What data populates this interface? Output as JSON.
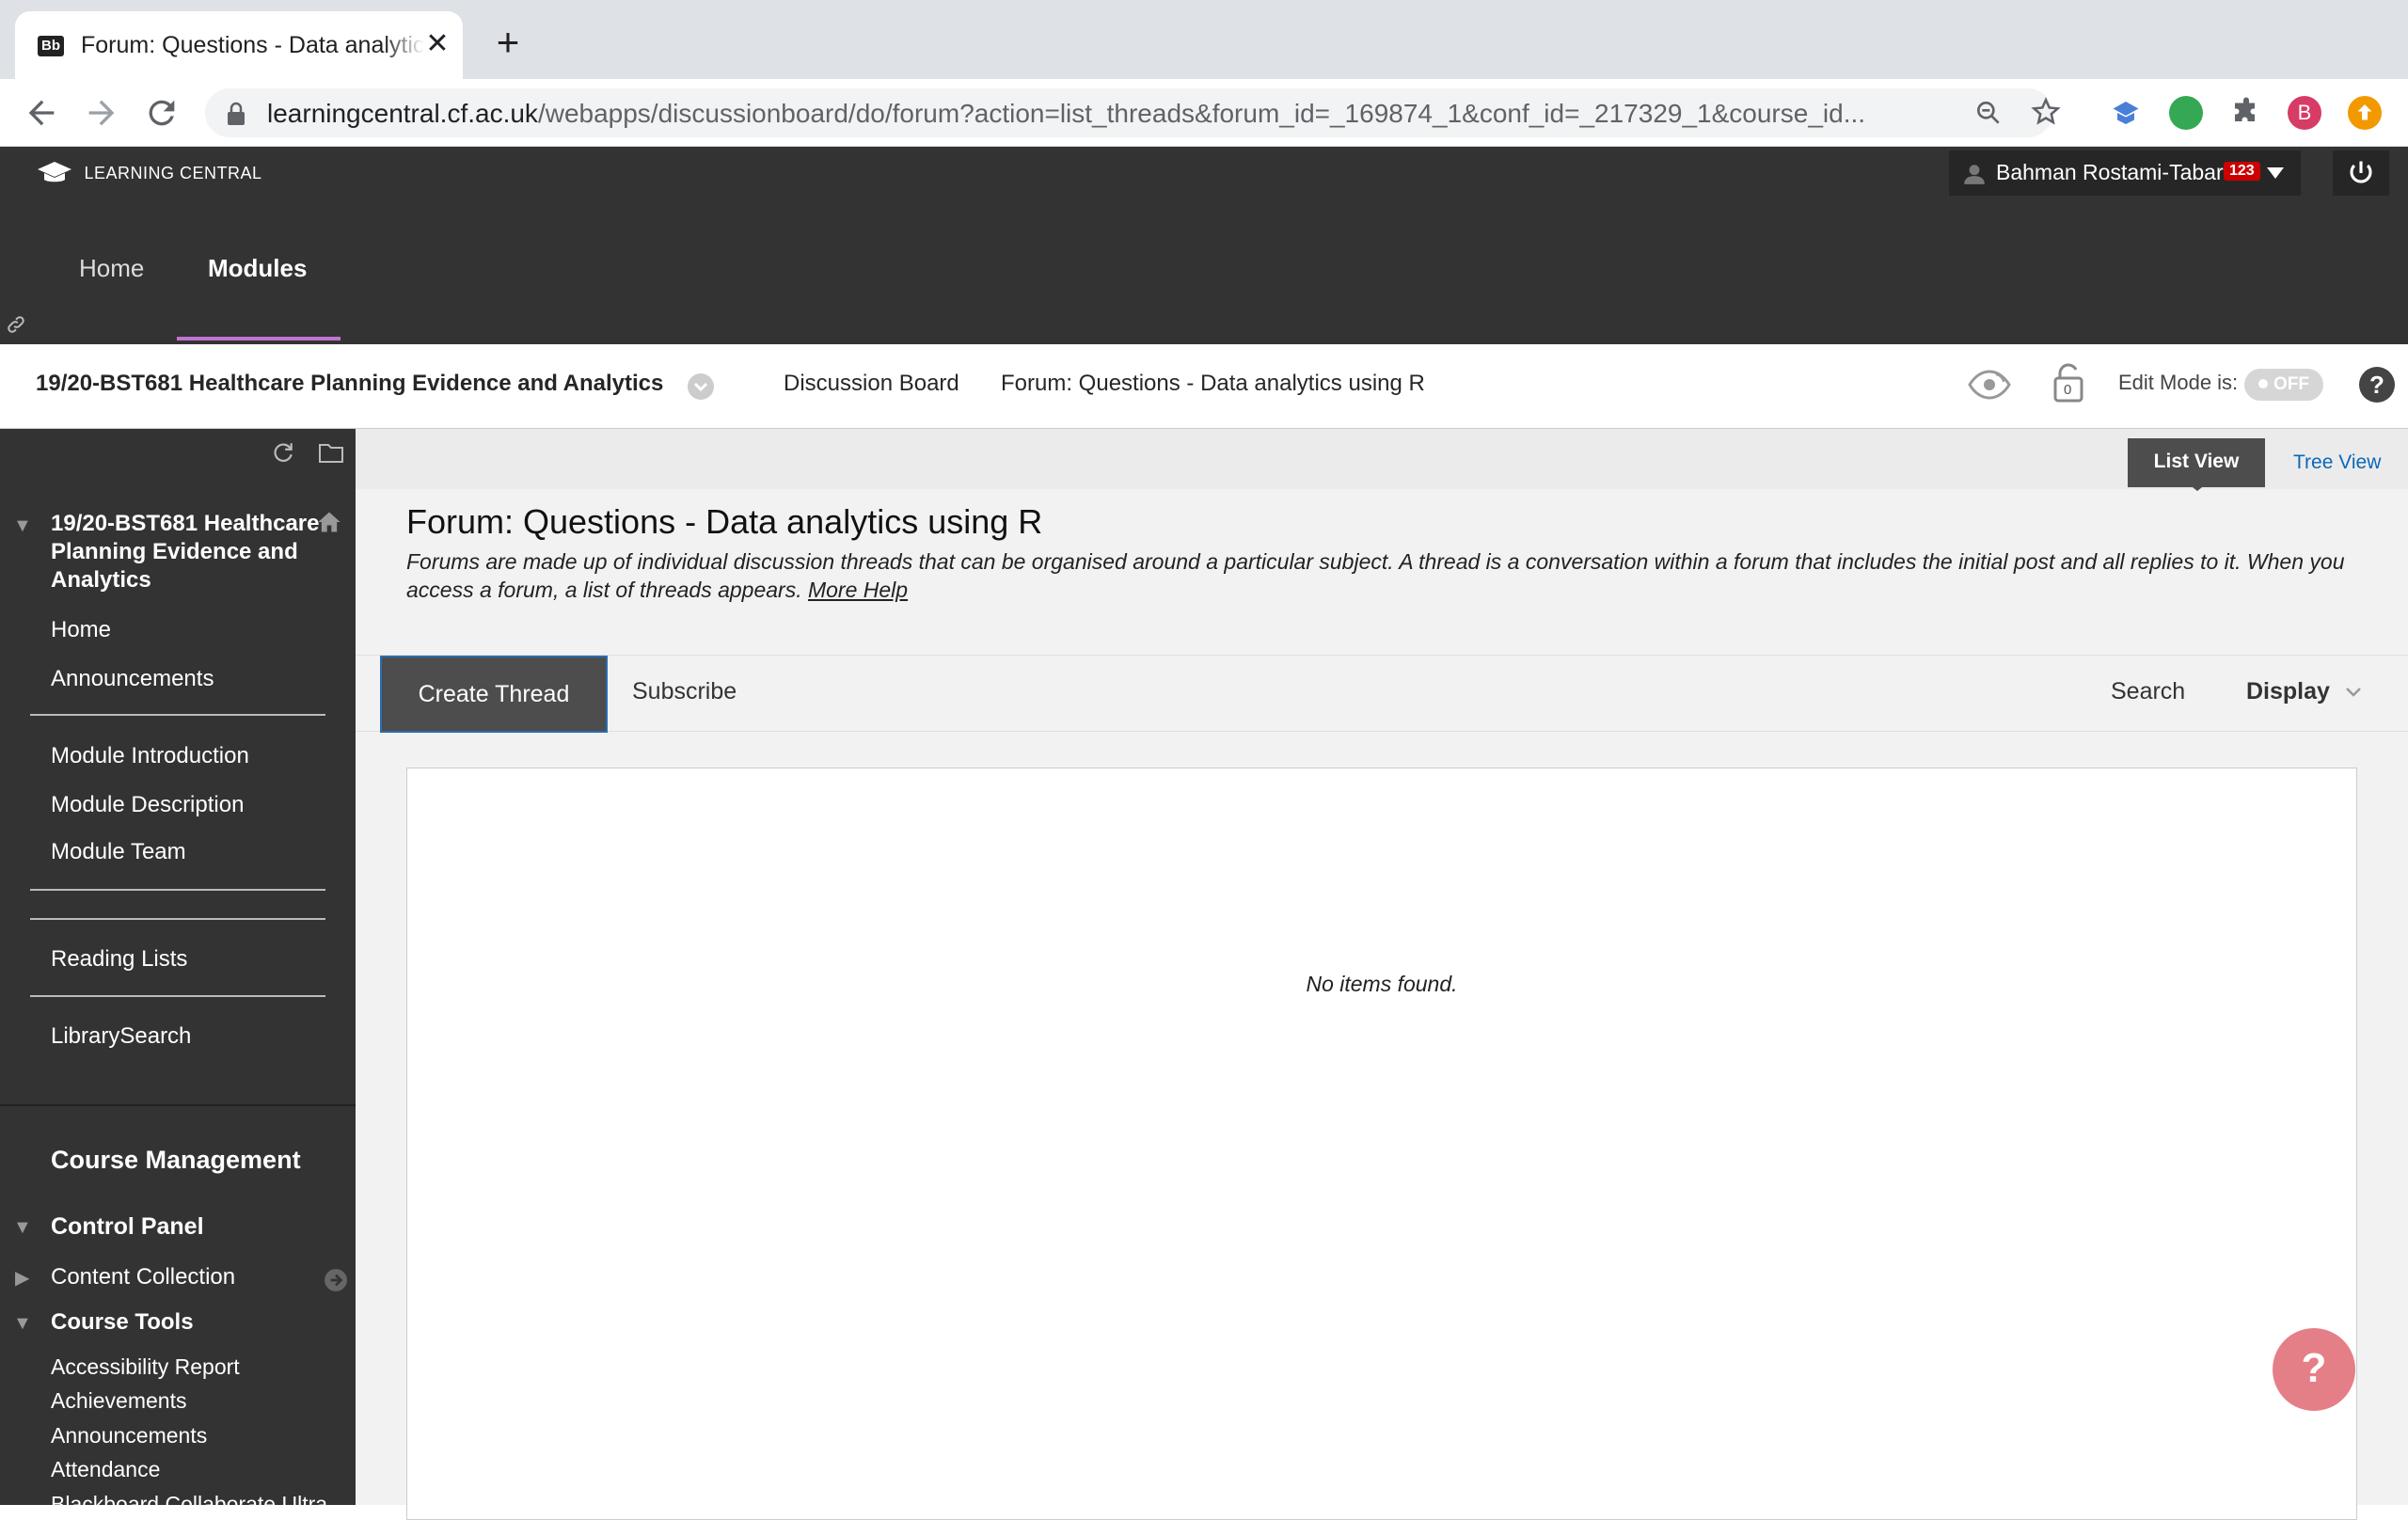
{
  "browser": {
    "tab_title": "Forum: Questions - Data analytics using R",
    "tab_favicon": "Bb",
    "close_glyph": "✕",
    "newtab_glyph": "+",
    "url_host": "learningcentral.cf.ac.uk",
    "url_path": "/webapps/discussionboard/do/forum?action=list_threads&forum_id=_169874_1&conf_id=_217329_1&course_id...",
    "profile_initial": "B",
    "icons": [
      "back-icon",
      "forward-icon",
      "reload-icon",
      "lock-icon",
      "zoom-icon",
      "star-icon",
      "extension-blue-icon",
      "extension-green-icon",
      "puzzle-icon",
      "profile-icon",
      "update-icon"
    ]
  },
  "header": {
    "logo_text": "LEARNING CENTRAL",
    "user_name": "Bahman Rostami-Tabar",
    "notification_count": "123",
    "nav": {
      "home": "Home",
      "modules": "Modules"
    },
    "accent_color": "#c373d1"
  },
  "breadcrumb": {
    "course": "19/20-BST681 Healthcare Planning Evidence and Analytics",
    "discussion_board": "Discussion Board",
    "forum": "Forum: Questions - Data analytics using R",
    "edit_mode_label": "Edit Mode is:",
    "edit_mode_value": "OFF",
    "lock_count": "0",
    "help_glyph": "?"
  },
  "sidebar": {
    "course_title": "19/20-BST681 Healthcare Planning Evidence and Analytics",
    "links": {
      "home": "Home",
      "announcements": "Announcements",
      "module_intro": "Module Introduction",
      "module_desc": "Module Description",
      "module_team": "Module Team",
      "reading_lists": "Reading Lists",
      "library_search": "LibrarySearch"
    },
    "course_management": "Course Management",
    "control_panel": "Control Panel",
    "content_collection": "Content Collection",
    "course_tools": "Course Tools",
    "tools": [
      "Accessibility Report",
      "Achievements",
      "Announcements",
      "Attendance",
      "Blackboard Collaborate Ultra"
    ]
  },
  "content": {
    "list_view": "List View",
    "tree_view": "Tree View",
    "forum_title": "Forum: Questions - Data analytics using R",
    "forum_description": "Forums are made up of individual discussion threads that can be organised around a particular subject. A thread is a conversation within a forum that includes the initial post and all replies to it. When you access a forum, a list of threads appears.",
    "more_help": "More Help",
    "create_thread": "Create Thread",
    "subscribe": "Subscribe",
    "search": "Search",
    "display": "Display",
    "empty_message": "No items found.",
    "help_fab": "?"
  }
}
